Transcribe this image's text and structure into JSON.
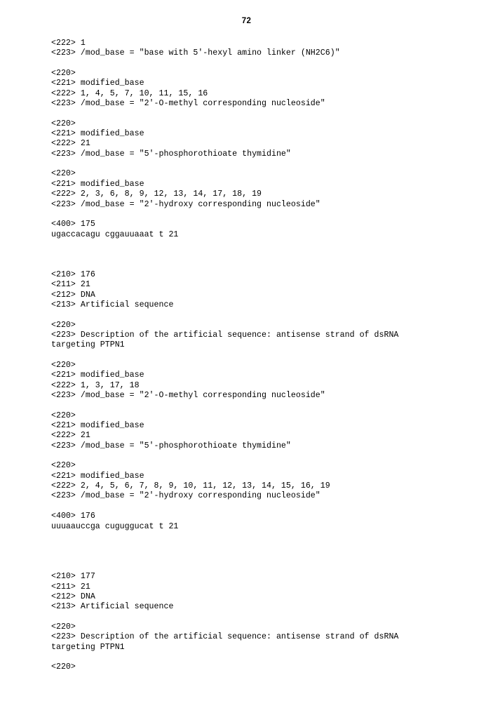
{
  "document": {
    "page_number": "72",
    "type": "patent-sequence-listing",
    "lines": [
      "<222> 1",
      "<223> /mod_base = \"base with 5'-hexyl amino linker (NH2C6)\"",
      "",
      "<220>",
      "<221> modified_base",
      "<222> 1, 4, 5, 7, 10, 11, 15, 16",
      "<223> /mod_base = \"2'-O-methyl corresponding nucleoside\"",
      "",
      "<220>",
      "<221> modified_base",
      "<222> 21",
      "<223> /mod_base = \"5'-phosphorothioate thymidine\"",
      "",
      "<220>",
      "<221> modified_base",
      "<222> 2, 3, 6, 8, 9, 12, 13, 14, 17, 18, 19",
      "<223> /mod_base = \"2'-hydroxy corresponding nucleoside\"",
      "",
      "<400> 175",
      "ugaccacagu cggauuaaat t 21",
      "",
      "",
      "",
      "<210> 176",
      "<211> 21",
      "<212> DNA",
      "<213> Artificial sequence",
      "",
      "<220>",
      "<223> Description of the artificial sequence: antisense strand of dsRNA",
      "targeting PTPN1",
      "",
      "<220>",
      "<221> modified_base",
      "<222> 1, 3, 17, 18",
      "<223> /mod_base = \"2'-O-methyl corresponding nucleoside\"",
      "",
      "<220>",
      "<221> modified_base",
      "<222> 21",
      "<223> /mod_base = \"5'-phosphorothioate thymidine\"",
      "",
      "<220>",
      "<221> modified_base",
      "<222> 2, 4, 5, 6, 7, 8, 9, 10, 11, 12, 13, 14, 15, 16, 19",
      "<223> /mod_base = \"2'-hydroxy corresponding nucleoside\"",
      "",
      "<400> 176",
      "uuuaauccga cuguggucat t 21",
      "",
      "",
      "",
      "",
      "<210> 177",
      "<211> 21",
      "<212> DNA",
      "<213> Artificial sequence",
      "",
      "<220>",
      "<223> Description of the artificial sequence: antisense strand of dsRNA",
      "targeting PTPN1",
      "",
      "<220>"
    ],
    "sequences": [
      {
        "seq_id": "175",
        "sequence": "ugaccacagu cggauuaaat t",
        "length": "21"
      },
      {
        "seq_id": "176",
        "sequence": "uuuaauccga cuguggucat t",
        "length": "21",
        "molecule_type": "DNA",
        "organism": "Artificial sequence",
        "description": "Description of the artificial sequence: antisense strand of dsRNA targeting PTPN1"
      },
      {
        "seq_id": "177",
        "length": "21",
        "molecule_type": "DNA",
        "organism": "Artificial sequence",
        "description": "Description of the artificial sequence: antisense strand of dsRNA targeting PTPN1"
      }
    ]
  }
}
